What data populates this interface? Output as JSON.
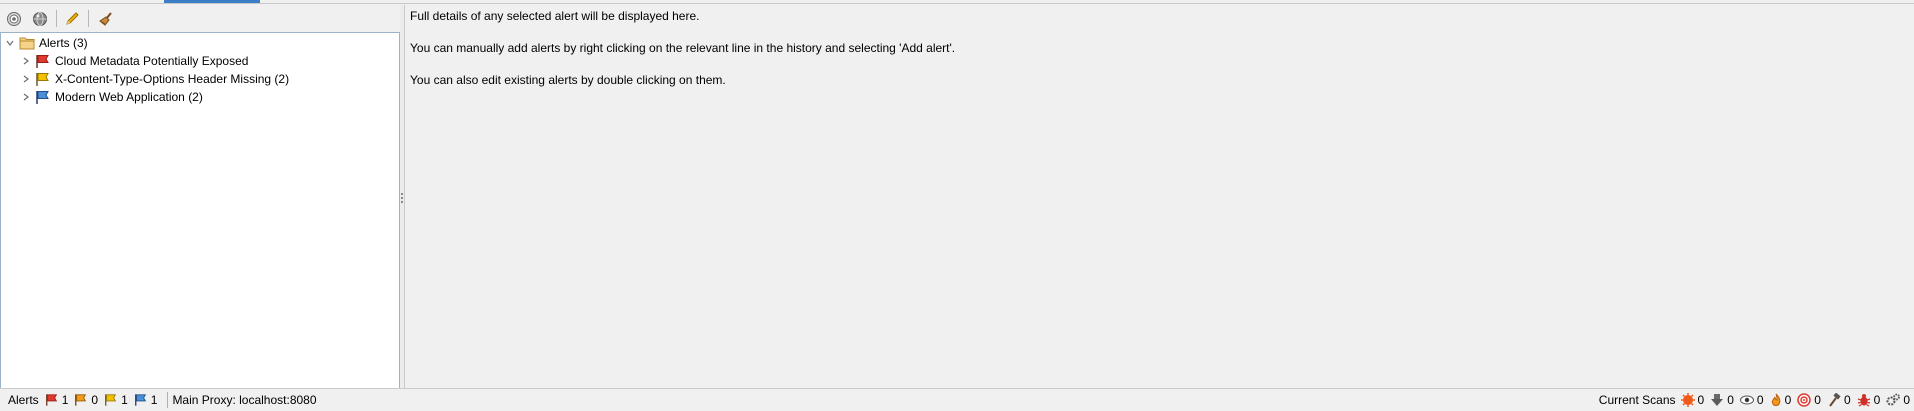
{
  "toolbar": {
    "buttons": [
      {
        "icon": "target-icon"
      },
      {
        "icon": "globe-icon"
      },
      {
        "icon": "pencil-icon"
      },
      {
        "icon": "broom-icon"
      }
    ]
  },
  "tree": {
    "root": {
      "label": "Alerts (3)",
      "icon": "folder-icon"
    },
    "items": [
      {
        "label": "Cloud Metadata Potentially Exposed",
        "flag_color": "#e03a2e",
        "risk": "high"
      },
      {
        "label": "X-Content-Type-Options Header Missing (2)",
        "flag_color": "#f2c200",
        "risk": "low"
      },
      {
        "label": "Modern Web Application (2)",
        "flag_color": "#4a8fd8",
        "risk": "informational"
      }
    ]
  },
  "details": {
    "lines": [
      "Full details of any selected alert will be displayed here.",
      "You can manually add alerts by right clicking on the relevant line in the history and selecting 'Add alert'.",
      "You can also edit existing alerts by double clicking on them."
    ]
  },
  "status": {
    "alerts_label": "Alerts",
    "alert_counts": [
      {
        "color": "#e03a2e",
        "count": "1",
        "icon": "high-risk-flag-icon"
      },
      {
        "color": "#f29a1a",
        "count": "0",
        "icon": "medium-risk-flag-icon"
      },
      {
        "color": "#f2c200",
        "count": "1",
        "icon": "low-risk-flag-icon"
      },
      {
        "color": "#4a8fd8",
        "count": "1",
        "icon": "info-risk-flag-icon"
      }
    ],
    "proxy": "Main Proxy: localhost:8080",
    "current_scans_label": "Current Scans",
    "scans": [
      {
        "icon": "active-scan-icon",
        "count": "0"
      },
      {
        "icon": "spider-download-icon",
        "count": "0"
      },
      {
        "icon": "eye-icon",
        "count": "0"
      },
      {
        "icon": "flame-icon",
        "count": "0"
      },
      {
        "icon": "target-scan-icon",
        "count": "0"
      },
      {
        "icon": "hammer-icon",
        "count": "0"
      },
      {
        "icon": "bug-icon",
        "count": "0"
      },
      {
        "icon": "gears-icon",
        "count": "0"
      }
    ]
  }
}
